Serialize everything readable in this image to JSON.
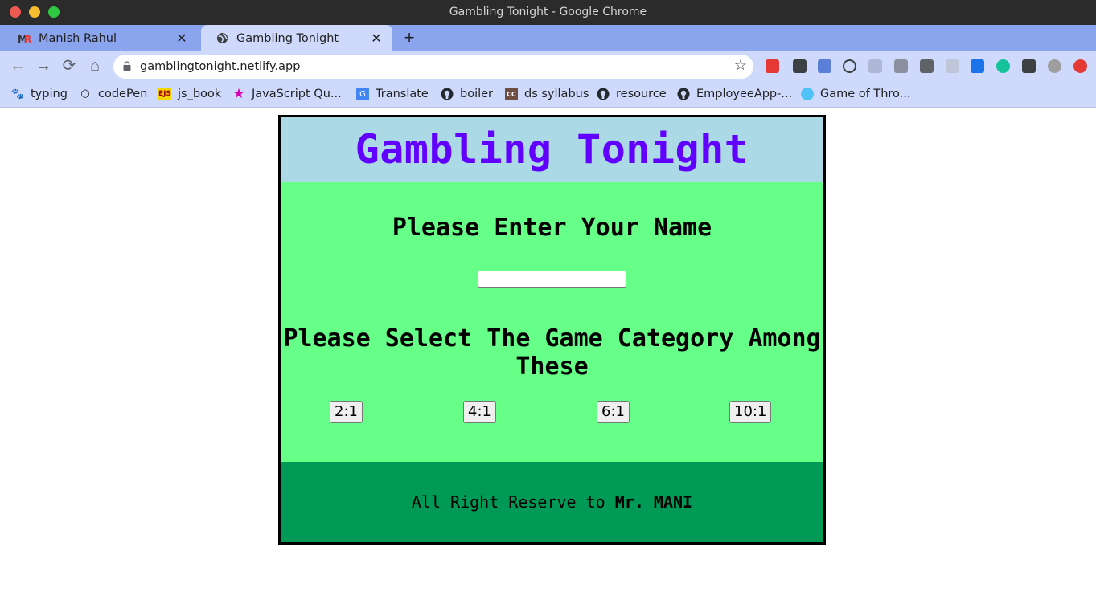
{
  "window": {
    "title": "Gambling Tonight - Google Chrome"
  },
  "tabs": [
    {
      "label": "Manish Rahul",
      "favicon": "MR",
      "active": false
    },
    {
      "label": "Gambling Tonight",
      "favicon": "globe-icon",
      "active": true
    }
  ],
  "toolbar": {
    "url": "gamblingtonight.netlify.app"
  },
  "bookmarks": [
    {
      "label": "typing",
      "icon": "paw-icon"
    },
    {
      "label": "codePen",
      "icon": "codepen-icon"
    },
    {
      "label": "js_book",
      "icon": "ejs-icon"
    },
    {
      "label": "JavaScript Qu...",
      "icon": "star-pink-icon"
    },
    {
      "label": "Translate",
      "icon": "translate-icon"
    },
    {
      "label": "boiler",
      "icon": "github-icon"
    },
    {
      "label": "ds syllabus",
      "icon": "cc-icon"
    },
    {
      "label": "resource",
      "icon": "github-icon"
    },
    {
      "label": "EmployeeApp-...",
      "icon": "github-icon"
    },
    {
      "label": "Game of Thro...",
      "icon": "got-icon"
    }
  ],
  "page": {
    "title": "Gambling Tonight",
    "name_prompt": "Please Enter Your Name",
    "name_value": "",
    "category_prompt": "Please Select The Game Category Among These",
    "odds": [
      "2:1",
      "4:1",
      "6:1",
      "10:1"
    ],
    "footer_prefix": "All Right Reserve to",
    "footer_owner": "Mr. MANI"
  },
  "colors": {
    "header_bg": "#abd9e6",
    "title": "#6100ff",
    "body_bg": "#66ff88",
    "footer_bg": "#009955"
  }
}
